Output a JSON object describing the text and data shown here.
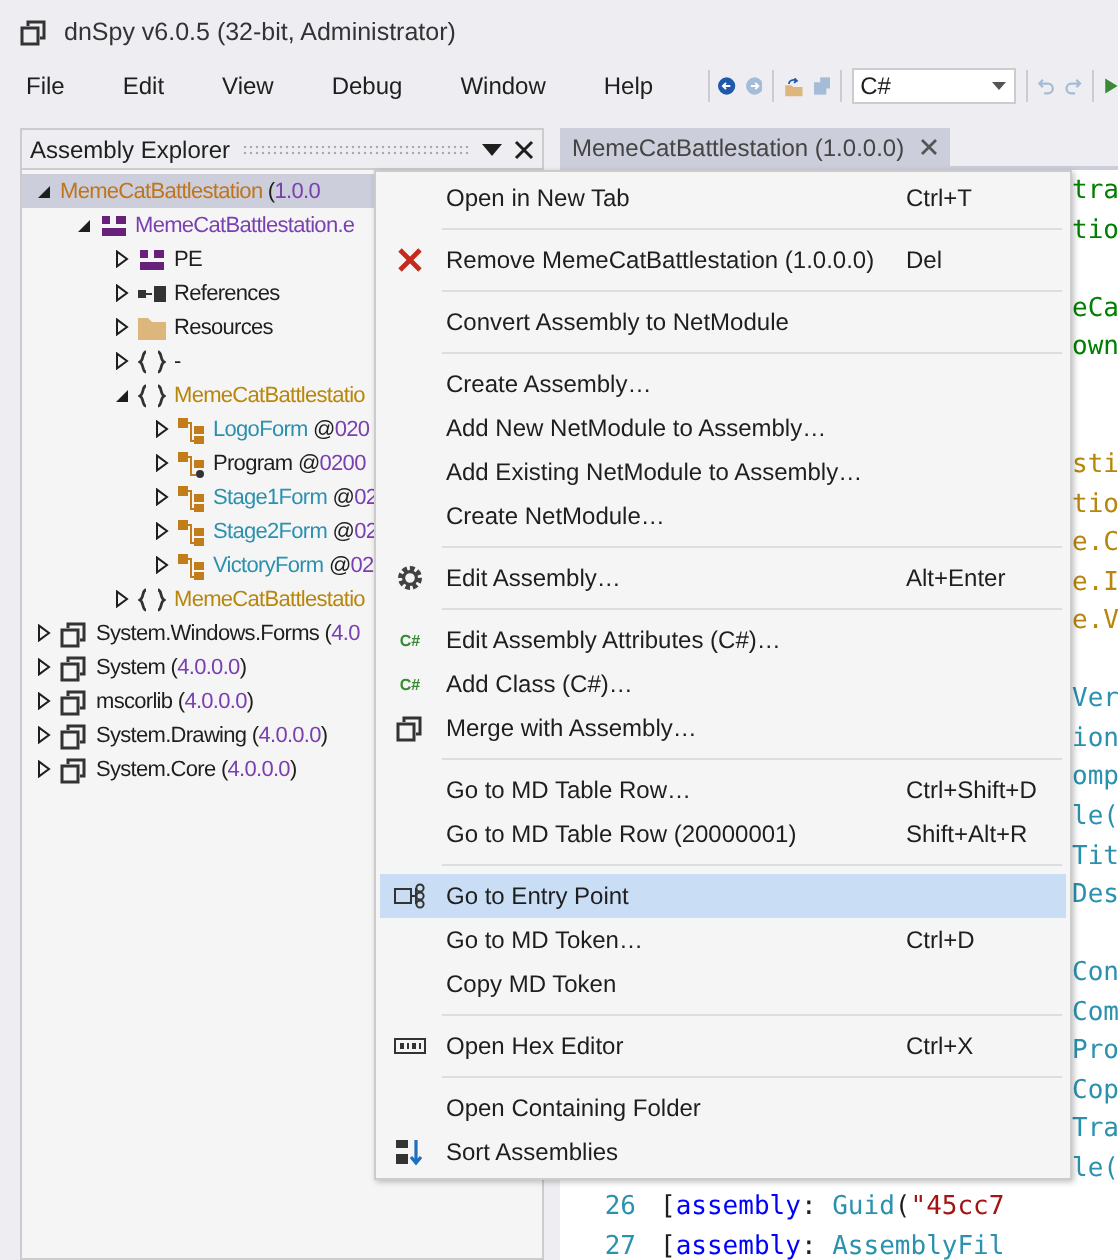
{
  "window": {
    "title": "dnSpy v6.0.5 (32-bit, Administrator)"
  },
  "menu_bar": [
    "File",
    "Edit",
    "View",
    "Debug",
    "Window",
    "Help"
  ],
  "toolbar": {
    "language": "C#"
  },
  "assembly_explorer": {
    "title": "Assembly Explorer",
    "tree": [
      {
        "kind": "main_assembly",
        "expanded": true,
        "selected": true,
        "segments": [
          {
            "kind": "name",
            "text": "MemeCatBattlestation"
          },
          {
            "kind": "punct",
            "text": " ("
          },
          {
            "kind": "version",
            "text": "1.0.0"
          }
        ],
        "children": [
          {
            "kind": "module",
            "expanded": true,
            "selected": false,
            "segments": [
              {
                "kind": "name",
                "text": "MemeCatBattlestation.e"
              }
            ],
            "children": [
              {
                "kind": "pe",
                "expanded": false,
                "selected": false,
                "segments": [
                  {
                    "kind": "name",
                    "text": "PE"
                  }
                ]
              },
              {
                "kind": "references",
                "expanded": false,
                "selected": false,
                "segments": [
                  {
                    "kind": "name",
                    "text": "References"
                  }
                ]
              },
              {
                "kind": "folder",
                "expanded": false,
                "selected": false,
                "segments": [
                  {
                    "kind": "name",
                    "text": "Resources"
                  }
                ]
              },
              {
                "kind": "namespace",
                "expanded": false,
                "selected": false,
                "segments": [
                  {
                    "kind": "punct",
                    "text": "-"
                  }
                ]
              },
              {
                "kind": "namespace",
                "expanded": true,
                "selected": false,
                "segments": [
                  {
                    "kind": "name",
                    "text": "MemeCatBattlestatio"
                  }
                ],
                "children": [
                  {
                    "kind": "class",
                    "expanded": false,
                    "selected": false,
                    "segments": [
                      {
                        "kind": "name",
                        "text": "LogoForm"
                      },
                      {
                        "kind": "punct",
                        "text": " @"
                      },
                      {
                        "kind": "token",
                        "text": "020"
                      }
                    ]
                  },
                  {
                    "kind": "static_class",
                    "expanded": false,
                    "selected": false,
                    "segments": [
                      {
                        "kind": "name",
                        "text": "Program"
                      },
                      {
                        "kind": "punct",
                        "text": " @"
                      },
                      {
                        "kind": "token",
                        "text": "0200"
                      }
                    ]
                  },
                  {
                    "kind": "class",
                    "expanded": false,
                    "selected": false,
                    "segments": [
                      {
                        "kind": "name",
                        "text": "Stage1Form"
                      },
                      {
                        "kind": "punct",
                        "text": " @"
                      },
                      {
                        "kind": "token",
                        "text": "02"
                      }
                    ]
                  },
                  {
                    "kind": "class",
                    "expanded": false,
                    "selected": false,
                    "segments": [
                      {
                        "kind": "name",
                        "text": "Stage2Form"
                      },
                      {
                        "kind": "punct",
                        "text": " @"
                      },
                      {
                        "kind": "token",
                        "text": "02"
                      }
                    ]
                  },
                  {
                    "kind": "class",
                    "expanded": false,
                    "selected": false,
                    "segments": [
                      {
                        "kind": "name",
                        "text": "VictoryForm"
                      },
                      {
                        "kind": "punct",
                        "text": " @"
                      },
                      {
                        "kind": "token",
                        "text": "02"
                      }
                    ]
                  }
                ]
              },
              {
                "kind": "namespace",
                "expanded": false,
                "selected": false,
                "segments": [
                  {
                    "kind": "name",
                    "text": "MemeCatBattlestatio"
                  }
                ]
              }
            ]
          }
        ]
      },
      {
        "kind": "assembly",
        "expanded": false,
        "selected": false,
        "segments": [
          {
            "kind": "name",
            "text": "System.Windows.Forms"
          },
          {
            "kind": "punct",
            "text": " ("
          },
          {
            "kind": "version",
            "text": "4.0"
          }
        ]
      },
      {
        "kind": "assembly",
        "expanded": false,
        "selected": false,
        "segments": [
          {
            "kind": "name",
            "text": "System"
          },
          {
            "kind": "punct",
            "text": " ("
          },
          {
            "kind": "version",
            "text": "4.0.0.0"
          },
          {
            "kind": "punct",
            "text": ")"
          }
        ]
      },
      {
        "kind": "assembly",
        "expanded": false,
        "selected": false,
        "segments": [
          {
            "kind": "name",
            "text": "mscorlib"
          },
          {
            "kind": "punct",
            "text": " ("
          },
          {
            "kind": "version",
            "text": "4.0.0.0"
          },
          {
            "kind": "punct",
            "text": ")"
          }
        ]
      },
      {
        "kind": "assembly",
        "expanded": false,
        "selected": false,
        "segments": [
          {
            "kind": "name",
            "text": "System.Drawing"
          },
          {
            "kind": "punct",
            "text": " ("
          },
          {
            "kind": "version",
            "text": "4.0.0.0"
          },
          {
            "kind": "punct",
            "text": ")"
          }
        ]
      },
      {
        "kind": "assembly",
        "expanded": false,
        "selected": false,
        "segments": [
          {
            "kind": "name",
            "text": "System.Core"
          },
          {
            "kind": "punct",
            "text": " ("
          },
          {
            "kind": "version",
            "text": "4.0.0.0"
          },
          {
            "kind": "punct",
            "text": ")"
          }
        ]
      }
    ]
  },
  "editor": {
    "tab": {
      "label": "MemeCatBattlestation (1.0.0.0)",
      "selected": true
    },
    "lines": [
      {
        "kind": "fragment",
        "segments": [
          {
            "kind": "comment",
            "text": "tra"
          }
        ]
      },
      {
        "kind": "fragment",
        "segments": [
          {
            "kind": "comment",
            "text": "tio"
          }
        ]
      },
      {
        "kind": "blank"
      },
      {
        "kind": "fragment",
        "segments": [
          {
            "kind": "comment",
            "text": "eCa"
          }
        ]
      },
      {
        "kind": "fragment",
        "segments": [
          {
            "kind": "comment",
            "text": "own"
          }
        ]
      },
      {
        "kind": "blank"
      },
      {
        "kind": "blank"
      },
      {
        "kind": "fragment",
        "segments": [
          {
            "kind": "namespace",
            "text": "sti"
          }
        ]
      },
      {
        "kind": "fragment",
        "segments": [
          {
            "kind": "namespace",
            "text": "tio"
          }
        ]
      },
      {
        "kind": "fragment",
        "segments": [
          {
            "kind": "namespace",
            "text": "e.C"
          }
        ]
      },
      {
        "kind": "fragment",
        "segments": [
          {
            "kind": "namespace",
            "text": "e.I"
          }
        ]
      },
      {
        "kind": "fragment",
        "segments": [
          {
            "kind": "namespace",
            "text": "e.V"
          }
        ]
      },
      {
        "kind": "blank"
      },
      {
        "kind": "fragment",
        "segments": [
          {
            "kind": "type",
            "text": "Ver"
          }
        ]
      },
      {
        "kind": "fragment",
        "segments": [
          {
            "kind": "type",
            "text": "ion"
          }
        ]
      },
      {
        "kind": "fragment",
        "segments": [
          {
            "kind": "type",
            "text": "omp"
          }
        ]
      },
      {
        "kind": "fragment",
        "segments": [
          {
            "kind": "type",
            "text": "le("
          }
        ]
      },
      {
        "kind": "fragment",
        "segments": [
          {
            "kind": "type",
            "text": "Tit"
          }
        ]
      },
      {
        "kind": "fragment",
        "segments": [
          {
            "kind": "type",
            "text": "Des"
          }
        ]
      },
      {
        "kind": "blank"
      },
      {
        "kind": "fragment",
        "segments": [
          {
            "kind": "type",
            "text": "Con"
          }
        ]
      },
      {
        "kind": "fragment",
        "segments": [
          {
            "kind": "type",
            "text": "Com"
          }
        ]
      },
      {
        "kind": "fragment",
        "segments": [
          {
            "kind": "type",
            "text": "Pro"
          }
        ]
      },
      {
        "kind": "fragment",
        "segments": [
          {
            "kind": "type",
            "text": "Cop"
          }
        ]
      },
      {
        "kind": "fragment",
        "segments": [
          {
            "kind": "type",
            "text": "Tra"
          }
        ]
      },
      {
        "kind": "fragment",
        "segments": [
          {
            "kind": "type",
            "text": "le("
          }
        ]
      },
      {
        "kind": "numbered",
        "number": "26",
        "segments": [
          {
            "kind": "punct",
            "text": "["
          },
          {
            "kind": "keyword",
            "text": "assembly"
          },
          {
            "kind": "punct",
            "text": ": "
          },
          {
            "kind": "type",
            "text": "Guid"
          },
          {
            "kind": "punct",
            "text": "("
          },
          {
            "kind": "string",
            "text": "\"45cc7"
          }
        ]
      },
      {
        "kind": "numbered",
        "number": "27",
        "segments": [
          {
            "kind": "punct",
            "text": "["
          },
          {
            "kind": "keyword",
            "text": "assembly"
          },
          {
            "kind": "punct",
            "text": ": "
          },
          {
            "kind": "type",
            "text": "AssemblyFil"
          }
        ]
      }
    ]
  },
  "context_menu": {
    "groups": [
      [
        {
          "kind": "plain",
          "label": "Open in New Tab",
          "shortcut": "Ctrl+T",
          "selected": false
        }
      ],
      [
        {
          "kind": "remove",
          "label": "Remove MemeCatBattlestation (1.0.0.0)",
          "shortcut": "Del",
          "selected": false
        }
      ],
      [
        {
          "kind": "plain",
          "label": "Convert Assembly to NetModule",
          "selected": false
        }
      ],
      [
        {
          "kind": "plain",
          "label": "Create Assembly…",
          "selected": false
        },
        {
          "kind": "plain",
          "label": "Add New NetModule to Assembly…",
          "selected": false
        },
        {
          "kind": "plain",
          "label": "Add Existing NetModule to Assembly…",
          "selected": false
        },
        {
          "kind": "plain",
          "label": "Create NetModule…",
          "selected": false
        }
      ],
      [
        {
          "kind": "gear",
          "label": "Edit Assembly…",
          "shortcut": "Alt+Enter",
          "selected": false
        }
      ],
      [
        {
          "kind": "csharp",
          "icon_text": "C#",
          "label": "Edit Assembly Attributes (C#)…",
          "selected": false
        },
        {
          "kind": "csharp",
          "icon_text": "C#",
          "label": "Add Class (C#)…",
          "selected": false
        },
        {
          "kind": "merge",
          "label": "Merge with Assembly…",
          "selected": false
        }
      ],
      [
        {
          "kind": "plain",
          "label": "Go to MD Table Row…",
          "shortcut": "Ctrl+Shift+D",
          "selected": false
        },
        {
          "kind": "plain",
          "label": "Go to MD Table Row (20000001)",
          "shortcut": "Shift+Alt+R",
          "selected": false
        }
      ],
      [
        {
          "kind": "entry",
          "label": "Go to Entry Point",
          "selected": true
        },
        {
          "kind": "plain",
          "label": "Go to MD Token…",
          "shortcut": "Ctrl+D",
          "selected": false
        },
        {
          "kind": "plain",
          "label": "Copy MD Token",
          "selected": false
        }
      ],
      [
        {
          "kind": "hex",
          "label": "Open Hex Editor",
          "shortcut": "Ctrl+X",
          "selected": false
        }
      ],
      [
        {
          "kind": "plain",
          "label": "Open Containing Folder",
          "selected": false
        },
        {
          "kind": "sort",
          "label": "Sort Assemblies",
          "selected": false
        }
      ]
    ]
  }
}
